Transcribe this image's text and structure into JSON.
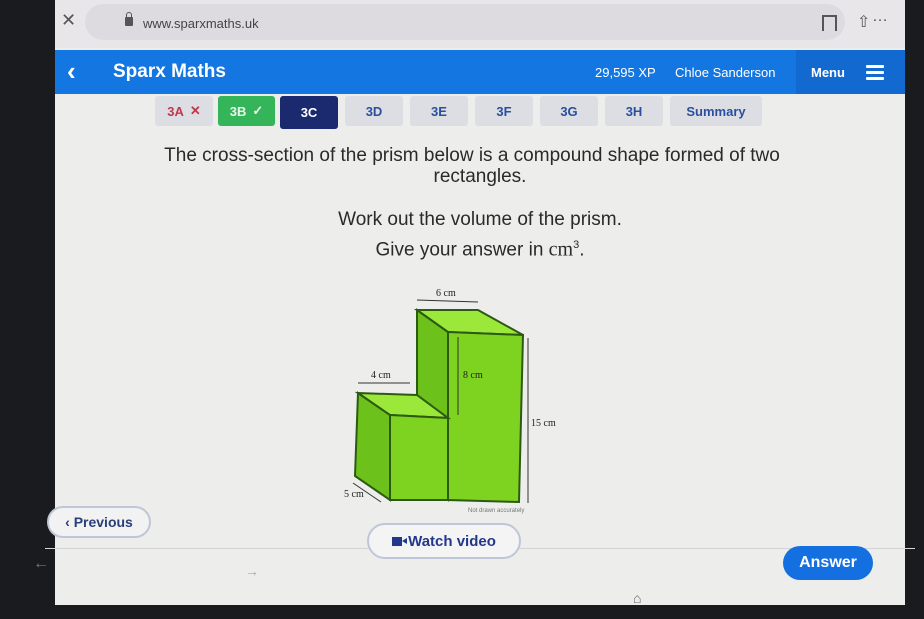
{
  "browser": {
    "close_icon": "close-icon",
    "url": "www.sparxmaths.uk",
    "bookmark_icon": "bookmark-icon",
    "share_icon": "share-icon",
    "more_label": "…"
  },
  "header": {
    "back_label": "‹",
    "title": "Sparx Maths",
    "xp": "29,595 XP",
    "user": "Chloe Sanderson",
    "menu_label": "Menu"
  },
  "tabs": [
    {
      "label": "3A",
      "status": "wrong",
      "mark": "✕"
    },
    {
      "label": "3B",
      "status": "right",
      "mark": "✓"
    },
    {
      "label": "3C",
      "status": "active",
      "mark": ""
    },
    {
      "label": "3D",
      "status": "",
      "mark": ""
    },
    {
      "label": "3E",
      "status": "",
      "mark": ""
    },
    {
      "label": "3F",
      "status": "",
      "mark": ""
    },
    {
      "label": "3G",
      "status": "",
      "mark": ""
    },
    {
      "label": "3H",
      "status": "",
      "mark": ""
    },
    {
      "label": "Summary",
      "status": "",
      "mark": ""
    }
  ],
  "question": {
    "line1": "The cross-section of the prism below is a compound shape formed of two",
    "line2": "rectangles.",
    "line3": "Work out the volume of the prism.",
    "line4_prefix": "Give your answer in ",
    "line4_unit": "cm",
    "line4_power": "3",
    "line4_suffix": "."
  },
  "diagram": {
    "label_top_width": "6 cm",
    "label_step_width": "4 cm",
    "label_step_drop": "8 cm",
    "label_height": "15 cm",
    "label_depth": "5 cm",
    "note": "Not drawn accurately",
    "fill_front": "#7ed321",
    "fill_top": "#9be83a",
    "fill_side": "#6cc21a",
    "stroke": "#2d5a12"
  },
  "actions": {
    "previous_label": "‹ Previous",
    "watch_video_label": "Watch video",
    "answer_label": "Answer"
  },
  "nav": {
    "back_arrow": "←",
    "forward_arrow": "→",
    "home_icon": "⌂"
  }
}
